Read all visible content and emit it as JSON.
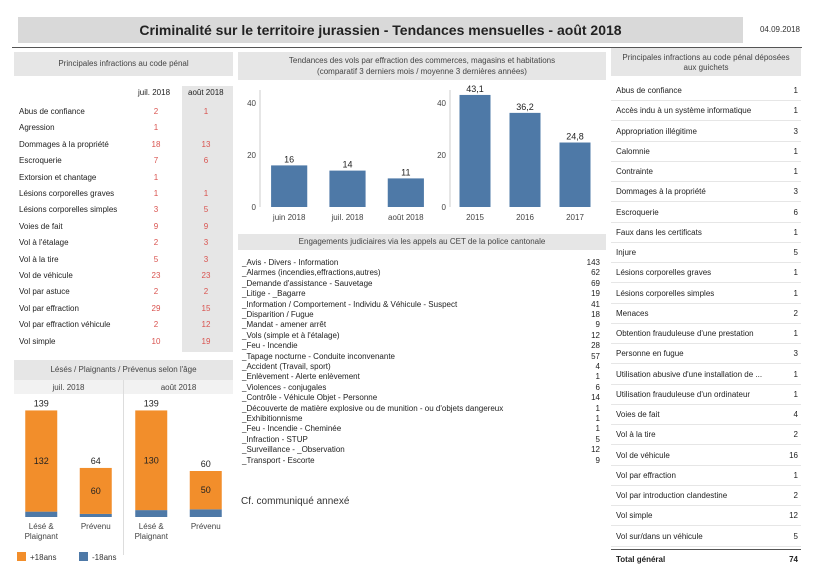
{
  "header": {
    "title": "Criminalité sur le territoire jurassien - Tendances mensuelles - août 2018",
    "date": "04.09.2018"
  },
  "left_table": {
    "title": "Principales infractions au code pénal",
    "col1": "juil. 2018",
    "col2": "août 2018",
    "rows": [
      {
        "name": "Abus de confiance",
        "v1": "2",
        "v2": "1"
      },
      {
        "name": "Agression",
        "v1": "1",
        "v2": ""
      },
      {
        "name": "Dommages à la propriété",
        "v1": "18",
        "v2": "13"
      },
      {
        "name": "Escroquerie",
        "v1": "7",
        "v2": "6"
      },
      {
        "name": "Extorsion et chantage",
        "v1": "1",
        "v2": ""
      },
      {
        "name": "Lésions corporelles graves",
        "v1": "1",
        "v2": "1"
      },
      {
        "name": "Lésions corporelles simples",
        "v1": "3",
        "v2": "5"
      },
      {
        "name": "Voies de fait",
        "v1": "9",
        "v2": "9"
      },
      {
        "name": "Vol à l'étalage",
        "v1": "2",
        "v2": "3"
      },
      {
        "name": "Vol à la tire",
        "v1": "5",
        "v2": "3"
      },
      {
        "name": "Vol de véhicule",
        "v1": "23",
        "v2": "23"
      },
      {
        "name": "Vol par astuce",
        "v1": "2",
        "v2": "2"
      },
      {
        "name": "Vol par effraction",
        "v1": "29",
        "v2": "15"
      },
      {
        "name": "Vol par effraction véhicule",
        "v1": "2",
        "v2": "12"
      },
      {
        "name": "Vol simple",
        "v1": "10",
        "v2": "19"
      }
    ]
  },
  "trend": {
    "title_line1": "Tendances des vols par effraction des commerces, magasins et habitations",
    "title_line2": "(comparatif 3 derniers mois / moyenne 3 dernières années)"
  },
  "chart_data": [
    {
      "type": "bar",
      "categories": [
        "juin 2018",
        "juil. 2018",
        "août 2018"
      ],
      "values": [
        16,
        14,
        11
      ],
      "ylim": [
        0,
        45
      ],
      "yticks": [
        "0",
        "20",
        "40"
      ],
      "color": "#4e79a7"
    },
    {
      "type": "bar",
      "categories": [
        "2015",
        "2016",
        "2017"
      ],
      "values": [
        43.1,
        36.2,
        24.8
      ],
      "value_labels": [
        "43,1",
        "36,2",
        "24,8"
      ],
      "ylim": [
        0,
        45
      ],
      "yticks": [
        "0",
        "20",
        "40"
      ],
      "color": "#4e79a7"
    },
    {
      "type": "bar",
      "title": "Lésés / Plaignants / Prévenus selon l'âge",
      "groups": [
        "juil. 2018",
        "août 2018"
      ],
      "categories": [
        "Lésé & Plaignant",
        "Prévenu"
      ],
      "series": [
        {
          "name": "+18ans",
          "color": "#f28e2b",
          "values": [
            [
              132,
              60
            ],
            [
              130,
              50
            ]
          ]
        },
        {
          "name": "-18ans",
          "color": "#4e79a7",
          "values": [
            [
              7,
              4
            ],
            [
              9,
              10
            ]
          ]
        }
      ],
      "totals": [
        [
          139,
          64
        ],
        [
          139,
          60
        ]
      ],
      "ylim": [
        0,
        150
      ]
    }
  ],
  "engagements": {
    "title": "Engagements judiciaires via les appels au CET de la police cantonale",
    "rows": [
      {
        "name": "_Avis - Divers - Information",
        "v": "143"
      },
      {
        "name": "_Alarmes (incendies,effractions,autres)",
        "v": "62"
      },
      {
        "name": "_Demande d'assistance - Sauvetage",
        "v": "69"
      },
      {
        "name": "_Litige - _Bagarre",
        "v": "19"
      },
      {
        "name": "_Information / Comportement - Individu & Véhicule - Suspect",
        "v": "41"
      },
      {
        "name": "_Disparition / Fugue",
        "v": "18"
      },
      {
        "name": "_Mandat - amener arrêt",
        "v": "9"
      },
      {
        "name": "_Vols (simple et à l'étalage)",
        "v": "12"
      },
      {
        "name": "_Feu - Incendie",
        "v": "28"
      },
      {
        "name": "_Tapage nocturne - Conduite inconvenante",
        "v": "57"
      },
      {
        "name": "_Accident (Travail, sport)",
        "v": "4"
      },
      {
        "name": "_Enlèvement - Alerte enlèvement",
        "v": "1"
      },
      {
        "name": "_Violences - conjugales",
        "v": "6"
      },
      {
        "name": "_Contrôle - Véhicule Objet - Personne",
        "v": "14"
      },
      {
        "name": "_Découverte de matière explosive ou de munition - ou d'objets dangereux",
        "v": "1"
      },
      {
        "name": "_Exhibitionnisme",
        "v": "1"
      },
      {
        "name": "_Feu - Incendie - Cheminée",
        "v": "1"
      },
      {
        "name": "_Infraction - STUP",
        "v": "5"
      },
      {
        "name": "_Surveillance - _Observation",
        "v": "12"
      },
      {
        "name": "_Transport - Escorte",
        "v": "9"
      }
    ]
  },
  "note": "Cf. communiqué annexé",
  "right_table": {
    "title_line1": "Principales infractions au code pénal déposées",
    "title_line2": "aux guichets",
    "rows": [
      {
        "name": "Abus de confiance",
        "v": "1"
      },
      {
        "name": "Accès indu à un système informatique",
        "v": "1"
      },
      {
        "name": "Appropriation illégitime",
        "v": "3"
      },
      {
        "name": "Calomnie",
        "v": "1"
      },
      {
        "name": "Contrainte",
        "v": "1"
      },
      {
        "name": "Dommages à la propriété",
        "v": "3"
      },
      {
        "name": "Escroquerie",
        "v": "6"
      },
      {
        "name": "Faux dans les certificats",
        "v": "1"
      },
      {
        "name": "Injure",
        "v": "5"
      },
      {
        "name": "Lésions corporelles graves",
        "v": "1"
      },
      {
        "name": "Lésions corporelles simples",
        "v": "1"
      },
      {
        "name": "Menaces",
        "v": "2"
      },
      {
        "name": "Obtention frauduleuse d'une prestation",
        "v": "1"
      },
      {
        "name": "Personne en fugue",
        "v": "3"
      },
      {
        "name": "Utilisation abusive d'une installation de ...",
        "v": "1"
      },
      {
        "name": "Utilisation frauduleuse d'un ordinateur",
        "v": "1"
      },
      {
        "name": "Voies de fait",
        "v": "4"
      },
      {
        "name": "Vol à la tire",
        "v": "2"
      },
      {
        "name": "Vol de véhicule",
        "v": "16"
      },
      {
        "name": "Vol par effraction",
        "v": "1"
      },
      {
        "name": "Vol par introduction clandestine",
        "v": "2"
      },
      {
        "name": "Vol simple",
        "v": "12"
      },
      {
        "name": "Vol sur/dans un véhicule",
        "v": "5"
      }
    ],
    "total_label": "Total général",
    "total_value": "74"
  }
}
